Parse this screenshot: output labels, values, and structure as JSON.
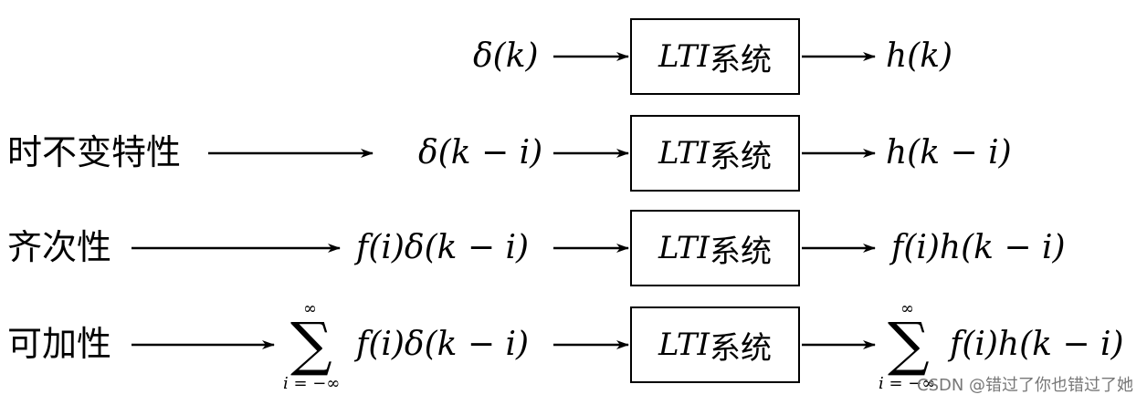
{
  "rows": [
    {
      "label": "",
      "input": "δ(k)",
      "system": {
        "lti": "LTI",
        "cn": "系统"
      },
      "output": "h(k)"
    },
    {
      "label": "时不变特性",
      "input": "δ(k − i)",
      "system": {
        "lti": "LTI",
        "cn": "系统"
      },
      "output": "h(k − i)"
    },
    {
      "label": "齐次性",
      "input": "f(i)δ(k − i)",
      "system": {
        "lti": "LTI",
        "cn": "系统"
      },
      "output": "f(i)h(k − i)"
    },
    {
      "label": "可加性",
      "input_sum": {
        "symbol": "∑",
        "upper": "∞",
        "lower": "i = −∞"
      },
      "input": "f(i)δ(k − i)",
      "system": {
        "lti": "LTI",
        "cn": "系统"
      },
      "output_sum": {
        "symbol": "∑",
        "upper": "∞",
        "lower": "i = −∞"
      },
      "output": "f(i)h(k − i)"
    }
  ],
  "watermark": "CSDN @错过了你也错过了她"
}
